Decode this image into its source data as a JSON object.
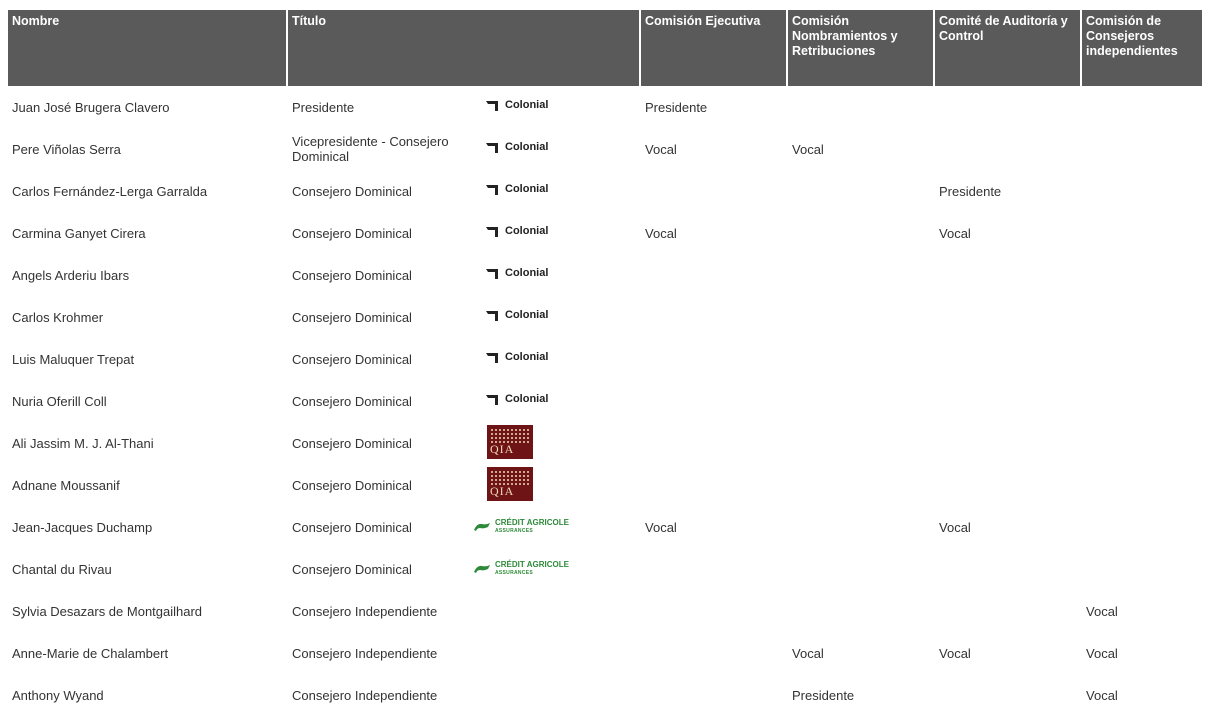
{
  "headers": [
    "Nombre",
    "Título",
    "",
    "Comisión Ejecutiva",
    "Comisión Nombramientos y Retribuciones",
    "Comité de Auditoría y Control",
    "Comisión de Consejeros independientes"
  ],
  "logos": {
    "colonial": {
      "name": "Colonial",
      "color": "#222222"
    },
    "qia": {
      "name": "QIA",
      "color": "#6e1417"
    },
    "credit_agricole": {
      "name": "CRÉDIT AGRICOLE",
      "sub": "ASSURANCES",
      "color": "#2e8a3a"
    }
  },
  "rows": [
    {
      "nombre": "Juan José Brugera Clavero",
      "titulo": "Presidente",
      "logo": "colonial",
      "ejecutiva": "Presidente",
      "nombramientos": "",
      "auditoria": "",
      "independientes": ""
    },
    {
      "nombre": "Pere Viñolas Serra",
      "titulo": "Vicepresidente - Consejero Dominical",
      "logo": "colonial",
      "ejecutiva": "Vocal",
      "nombramientos": "Vocal",
      "auditoria": "",
      "independientes": ""
    },
    {
      "nombre": "Carlos Fernández-Lerga  Garralda",
      "titulo": "Consejero Dominical",
      "logo": "colonial",
      "ejecutiva": "",
      "nombramientos": "",
      "auditoria": "Presidente",
      "independientes": ""
    },
    {
      "nombre": "Carmina Ganyet Cirera",
      "titulo": "Consejero Dominical",
      "logo": "colonial",
      "ejecutiva": "Vocal",
      "nombramientos": "",
      "auditoria": "Vocal",
      "independientes": ""
    },
    {
      "nombre": "Angels Arderiu Ibars",
      "titulo": "Consejero Dominical",
      "logo": "colonial",
      "ejecutiva": "",
      "nombramientos": "",
      "auditoria": "",
      "independientes": ""
    },
    {
      "nombre": "Carlos Krohmer",
      "titulo": "Consejero Dominical",
      "logo": "colonial",
      "ejecutiva": "",
      "nombramientos": "",
      "auditoria": "",
      "independientes": ""
    },
    {
      "nombre": "Luis Maluquer Trepat",
      "titulo": "Consejero Dominical",
      "logo": "colonial",
      "ejecutiva": "",
      "nombramientos": "",
      "auditoria": "",
      "independientes": ""
    },
    {
      "nombre": "Nuria Oferill Coll",
      "titulo": "Consejero Dominical",
      "logo": "colonial",
      "ejecutiva": "",
      "nombramientos": "",
      "auditoria": "",
      "independientes": ""
    },
    {
      "nombre": "Ali Jassim M. J. Al-Thani",
      "titulo": "Consejero Dominical",
      "logo": "qia",
      "ejecutiva": "",
      "nombramientos": "",
      "auditoria": "",
      "independientes": ""
    },
    {
      "nombre": "Adnane Moussanif",
      "titulo": "Consejero Dominical",
      "logo": "qia",
      "ejecutiva": "",
      "nombramientos": "",
      "auditoria": "",
      "independientes": ""
    },
    {
      "nombre": "Jean-Jacques Duchamp",
      "titulo": "Consejero Dominical",
      "logo": "credit_agricole",
      "ejecutiva": "Vocal",
      "nombramientos": "",
      "auditoria": "Vocal",
      "independientes": ""
    },
    {
      "nombre": "Chantal du Rivau",
      "titulo": "Consejero Dominical",
      "logo": "credit_agricole",
      "ejecutiva": "",
      "nombramientos": "",
      "auditoria": "",
      "independientes": ""
    },
    {
      "nombre": "Sylvia Desazars de Montgailhard",
      "titulo": "Consejero Independiente",
      "logo": "",
      "ejecutiva": "",
      "nombramientos": "",
      "auditoria": "",
      "independientes": "Vocal"
    },
    {
      "nombre": "Anne-Marie de Chalambert",
      "titulo": "Consejero Independiente",
      "logo": "",
      "ejecutiva": "",
      "nombramientos": "Vocal",
      "auditoria": "Vocal",
      "independientes": "Vocal"
    },
    {
      "nombre": "Anthony Wyand",
      "titulo": "Consejero Independiente",
      "logo": "",
      "ejecutiva": "",
      "nombramientos": "Presidente",
      "auditoria": "",
      "independientes": "Vocal"
    }
  ]
}
